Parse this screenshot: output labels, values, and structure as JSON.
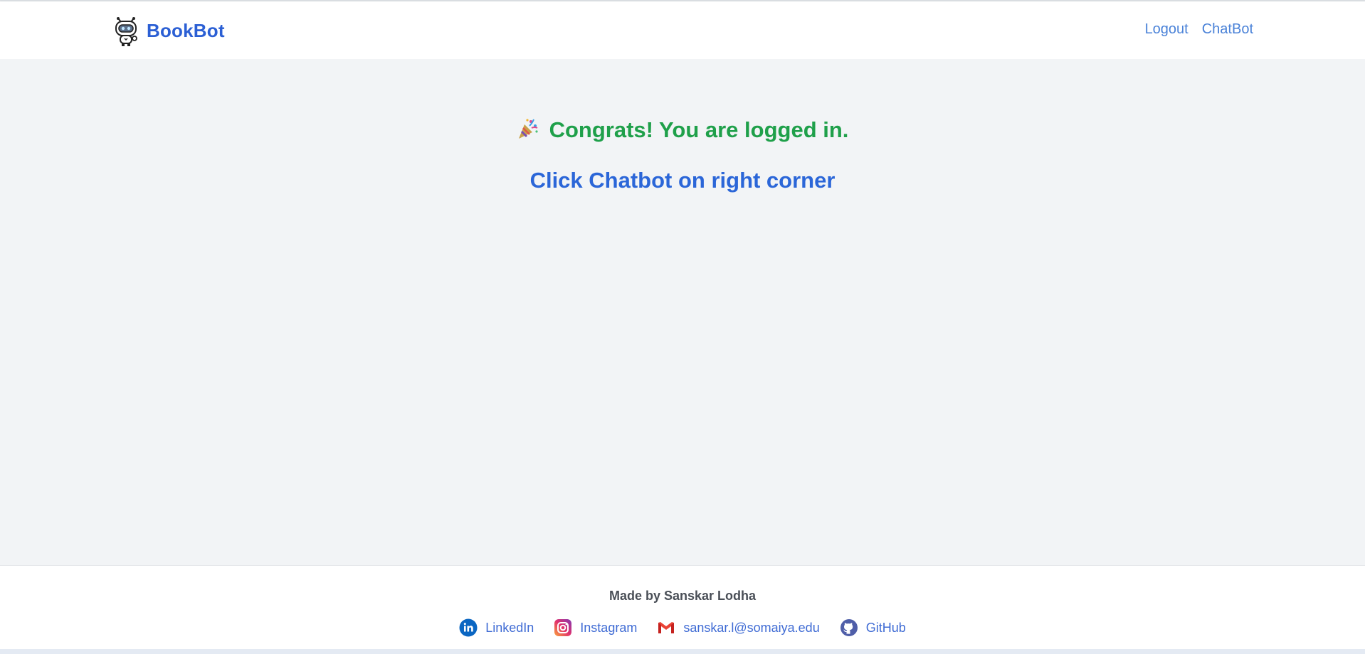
{
  "header": {
    "brand": "BookBot",
    "nav": [
      {
        "label": "Logout"
      },
      {
        "label": "ChatBot"
      }
    ]
  },
  "main": {
    "congrats": "Congrats! You are logged in.",
    "instruction": "Click Chatbot on right corner"
  },
  "footer": {
    "made_by": "Made by Sanskar Lodha",
    "links": [
      {
        "label": "LinkedIn",
        "icon": "linkedin-icon"
      },
      {
        "label": "Instagram",
        "icon": "instagram-icon"
      },
      {
        "label": "sanskar.l@somaiya.edu",
        "icon": "gmail-icon"
      },
      {
        "label": "GitHub",
        "icon": "github-icon"
      }
    ]
  },
  "colors": {
    "brand": "#2b5fd4",
    "nav_link": "#4a82d8",
    "success": "#1fa04a",
    "instruction": "#2b66d8",
    "background": "#f2f4f6"
  }
}
